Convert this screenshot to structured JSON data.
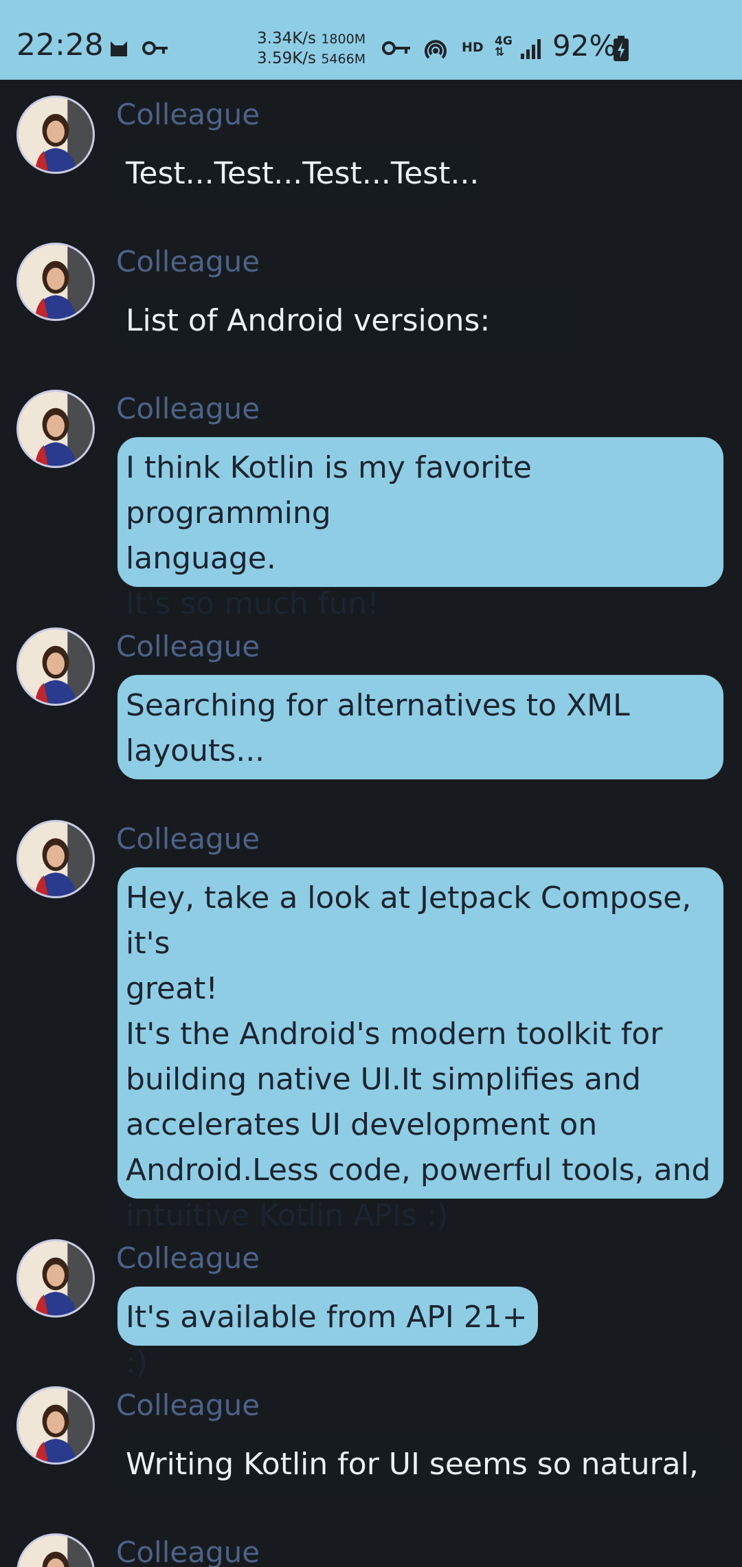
{
  "status_bar": {
    "time": "22:28",
    "net_up": "3.34K/s",
    "net_up_mem": "1800M",
    "net_down": "3.59K/s",
    "net_down_mem": "5466M",
    "hd": "HD",
    "network": "4G",
    "battery_pct": "92%",
    "icons": [
      "cat-icon",
      "key-icon",
      "vpn-key-icon",
      "hotspot-icon",
      "signal-icon",
      "battery-charging-icon"
    ]
  },
  "messages": [
    {
      "author": "Colleague",
      "text": "Test...Test...Test...Test...",
      "bubble": false
    },
    {
      "author": "Colleague",
      "text": "List of Android versions:",
      "bubble": false
    },
    {
      "author": "Colleague",
      "text": "I think Kotlin is my favorite programming\nlanguage.\nIt's so much fun!",
      "bubble": true
    },
    {
      "author": "Colleague",
      "text": "Searching for alternatives to XML\nlayouts...",
      "bubble": true
    },
    {
      "author": "Colleague",
      "text": "Hey, take a look at Jetpack Compose, it's\ngreat!\nIt's the Android's modern toolkit for\nbuilding native UI.It simplifies and\naccelerates UI development on\nAndroid.Less code, powerful tools, and\nintuitive Kotlin APIs :)",
      "bubble": true
    },
    {
      "author": "Colleague",
      "text": "It's available from API 21+ :)",
      "bubble": true
    },
    {
      "author": "Colleague",
      "text": "Writing Kotlin for UI seems so natural,",
      "bubble": false
    },
    {
      "author": "Colleague",
      "text": "",
      "bubble": false
    }
  ],
  "colors": {
    "background": "#171b1f",
    "status_bar": "#8fcde5",
    "bubble": "#8fcde5",
    "author": "#4e6287"
  }
}
